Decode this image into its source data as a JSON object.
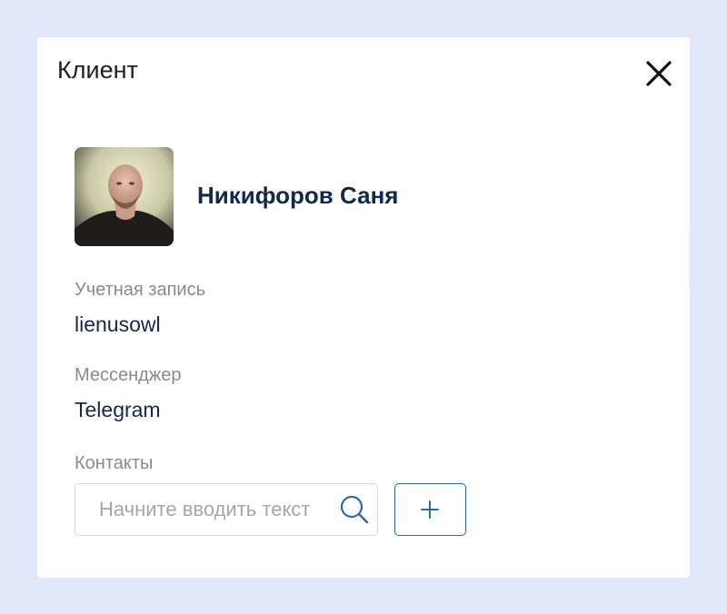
{
  "dialog": {
    "title": "Клиент"
  },
  "client": {
    "name": "Никифоров Саня"
  },
  "fields": {
    "account_label": "Учетная запись",
    "account_value": "lienusowl",
    "messenger_label": "Мессенджер",
    "messenger_value": "Telegram",
    "contacts_label": "Контакты"
  },
  "contacts": {
    "search_placeholder": "Начните вводить текст"
  },
  "icons": {
    "close": "close-icon",
    "search": "search-icon",
    "add": "plus-icon"
  },
  "colors": {
    "background": "#e0e7f8",
    "panel": "#ffffff",
    "name_text": "#13294b",
    "label_text": "#8a8a8a",
    "accent": "#2f6aa5"
  }
}
